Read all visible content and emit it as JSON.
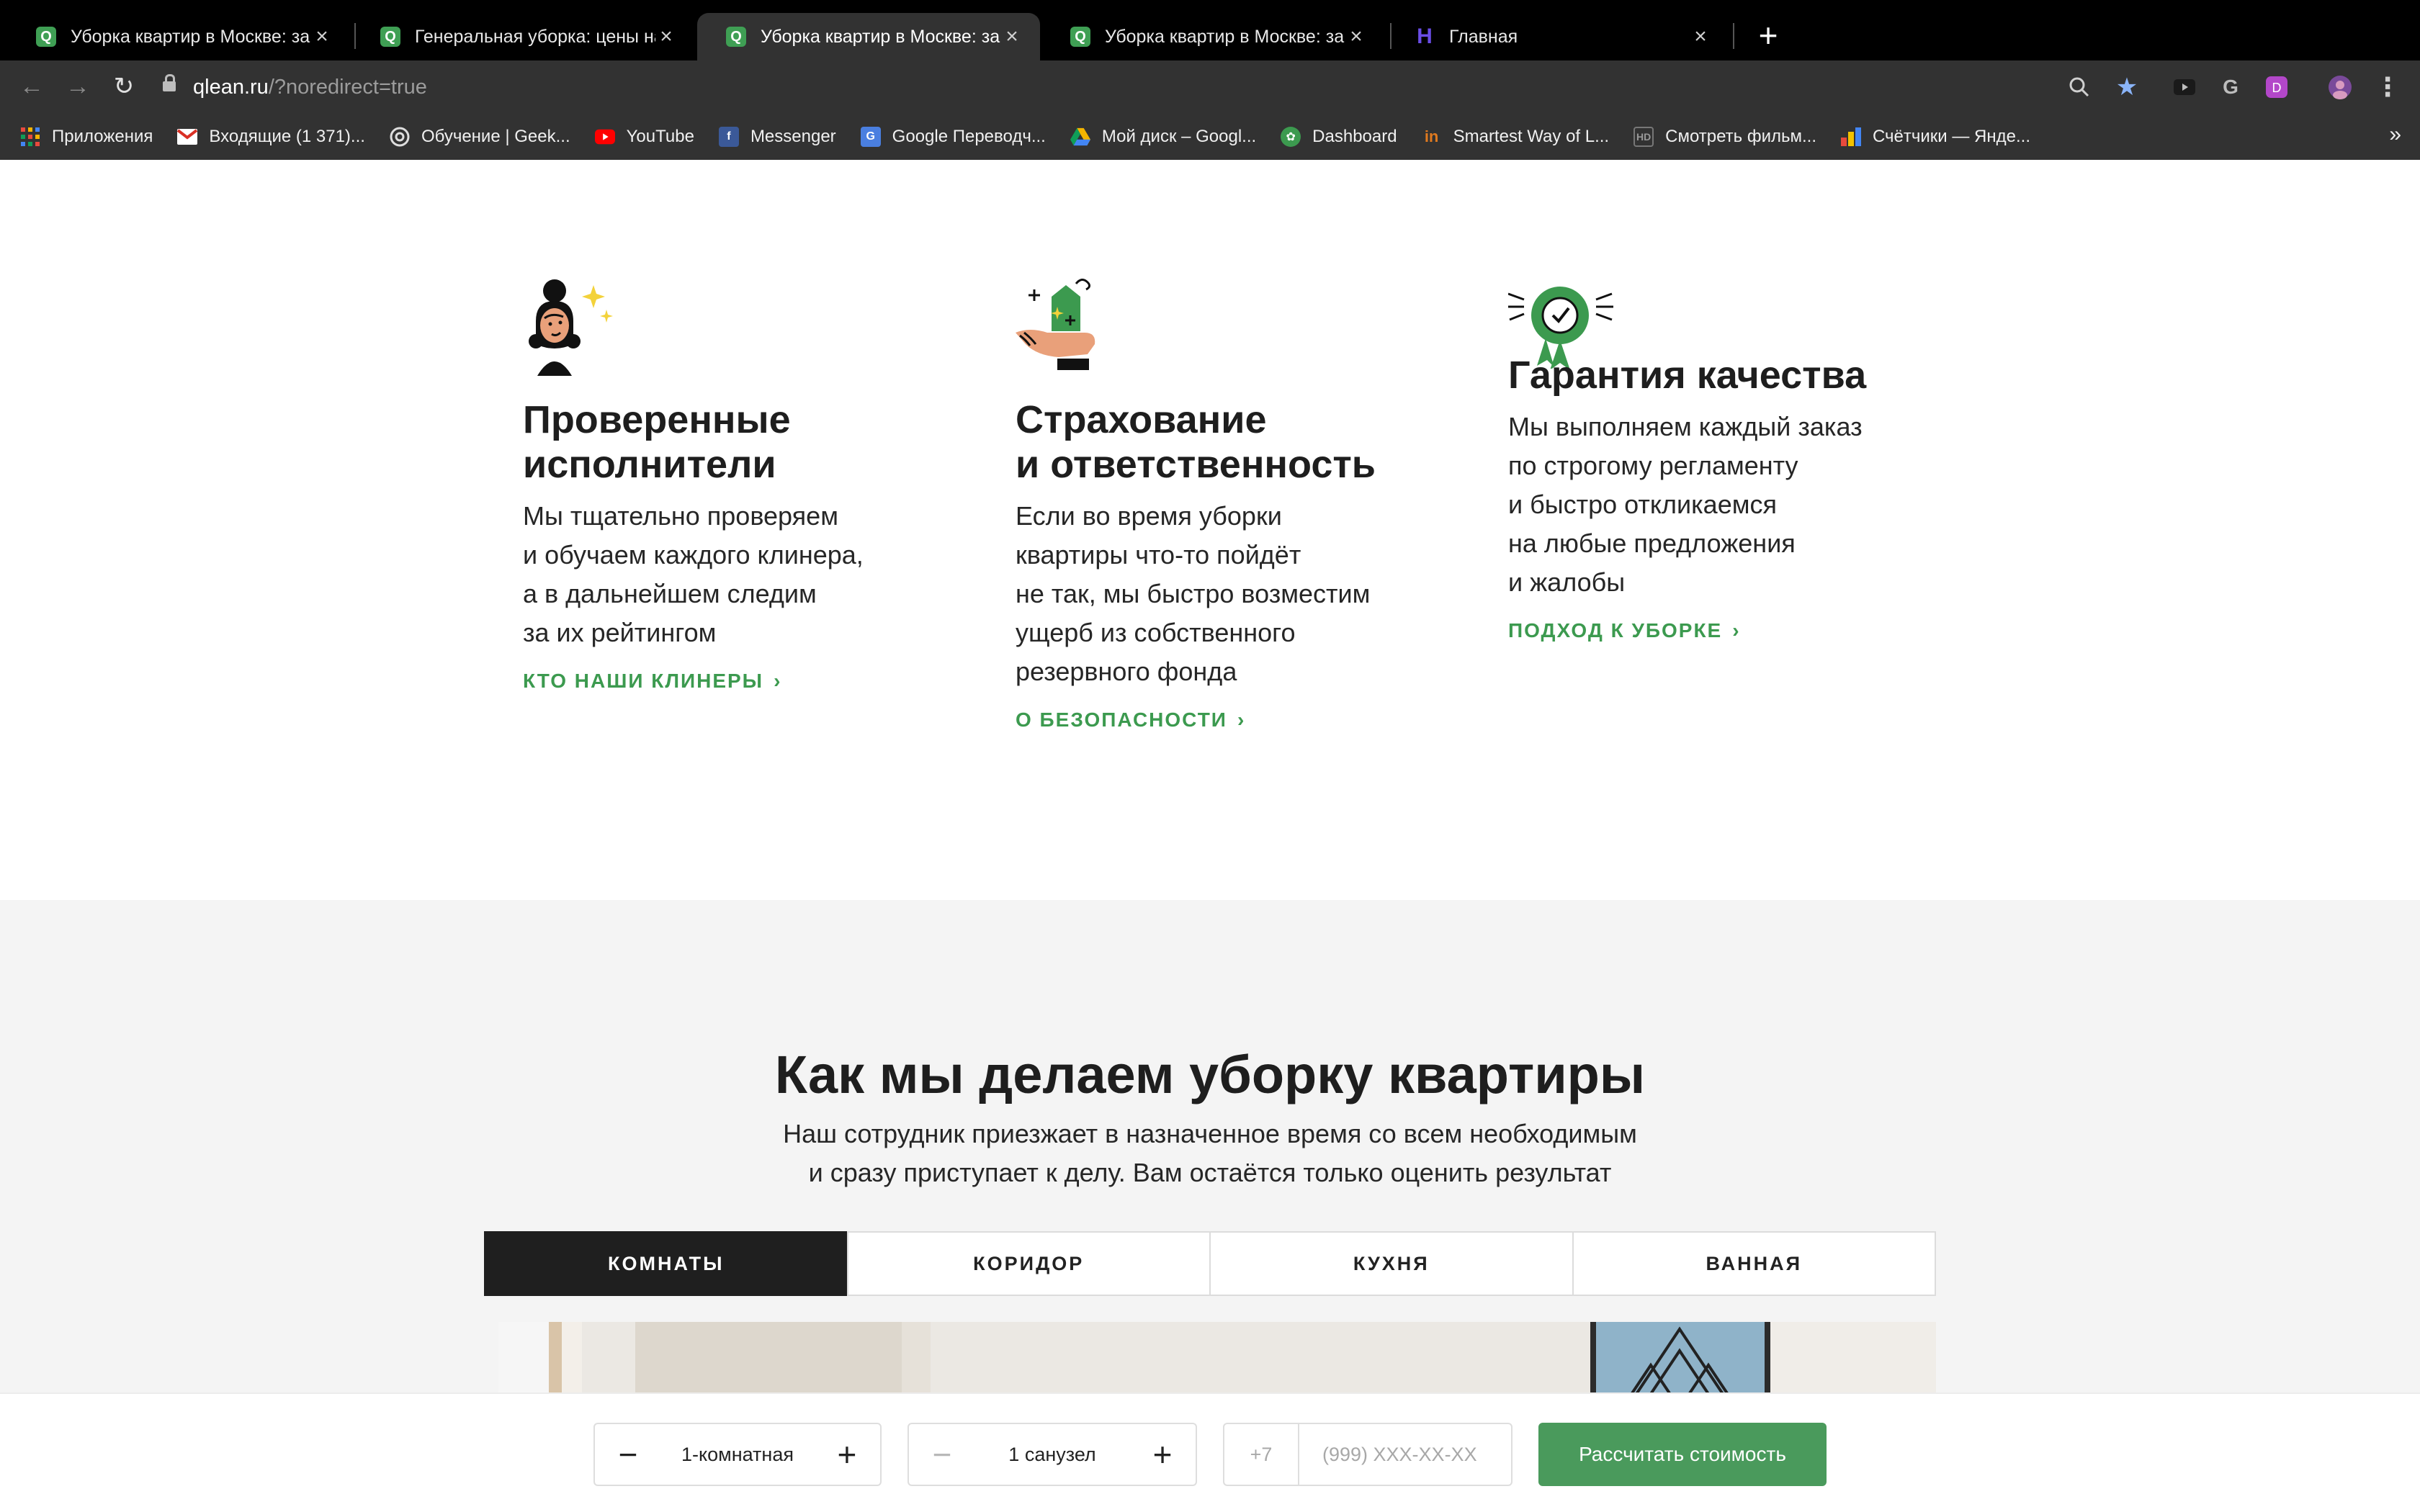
{
  "browser": {
    "tabs": [
      {
        "title": "Уборка квартир в Москве: за",
        "favicon": "Q",
        "active": false
      },
      {
        "title": "Генеральная уборка: цены на",
        "favicon": "Q",
        "active": false
      },
      {
        "title": "Уборка квартир в Москве: за",
        "favicon": "Q",
        "active": true
      },
      {
        "title": "Уборка квартир в Москве: за",
        "favicon": "Q",
        "active": false
      },
      {
        "title": "Главная",
        "favicon": "H",
        "active": false
      }
    ],
    "close_glyph": "×",
    "new_tab_glyph": "+",
    "url_host": "qlean.ru",
    "url_path": "/?noredirect=true",
    "bookmarks": [
      {
        "label": "Приложения",
        "icon": "apps-grid-icon",
        "color": "#e8a33d"
      },
      {
        "label": "Входящие (1 371)...",
        "icon": "gmail-icon",
        "color": "#d93025"
      },
      {
        "label": "Обучение | Geek...",
        "icon": "geekbrains-icon",
        "color": "#888888"
      },
      {
        "label": "YouTube",
        "icon": "youtube-icon",
        "color": "#ff0000"
      },
      {
        "label": "Messenger",
        "icon": "facebook-icon",
        "color": "#3b5998"
      },
      {
        "label": "Google Переводч...",
        "icon": "google-translate-icon",
        "color": "#4a7fe0"
      },
      {
        "label": "Мой диск – Googl...",
        "icon": "google-drive-icon",
        "color": "#2a9d55"
      },
      {
        "label": "Dashboard",
        "icon": "dashboard-icon",
        "color": "#3c9a4f"
      },
      {
        "label": "Smartest Way of L...",
        "icon": "learning-icon",
        "color": "#e07a1f"
      },
      {
        "label": "Смотреть фильм...",
        "icon": "hd-icon",
        "color": "#555555"
      },
      {
        "label": "Счётчики — Янде...",
        "icon": "yandex-metrica-icon",
        "color": "#f2c200"
      }
    ],
    "more_glyph": "»"
  },
  "features": [
    {
      "title_line1": "Проверенные",
      "title_line2": "исполнители",
      "text": [
        "Мы тщательно проверяем",
        "и обучаем каждого клинера,",
        "а в дальнейшем следим",
        "за их рейтингом"
      ],
      "link": "КТО НАШИ КЛИНЕРЫ",
      "icon": "cleaner-woman-icon"
    },
    {
      "title_line1": "Страхование",
      "title_line2": "и ответственность",
      "text": [
        "Если во время уборки",
        "квартиры что-то пойдёт",
        "не так, мы быстро возместим",
        "ущерб из собственного",
        "резервного фонда"
      ],
      "link": "О БЕЗОПАСНОСТИ",
      "icon": "insurance-hand-icon"
    },
    {
      "title_line1": "Гарантия качества",
      "title_line2": "",
      "text": [
        "Мы выполняем каждый заказ",
        "по строгому регламенту",
        "и быстро откликаемся",
        "на любые предложения",
        "и жалобы"
      ],
      "link": "ПОДХОД К УБОРКЕ",
      "icon": "quality-badge-icon"
    }
  ],
  "link_chevron": "›",
  "how": {
    "title": "Как мы делаем уборку квартиры",
    "subtitle_line1": "Наш сотрудник приезжает в назначенное время со всем необходимым",
    "subtitle_line2": "и сразу приступает к делу. Вам остаётся только оценить результат",
    "tabs": [
      "КОМНАТЫ",
      "КОРИДОР",
      "КУХНЯ",
      "ВАННАЯ"
    ],
    "active_tab": 0
  },
  "calculator": {
    "rooms_value": "1-комнатная",
    "bathrooms_value": "1 санузел",
    "minus": "−",
    "plus": "+",
    "phone_code": "+7",
    "phone_placeholder": "(999) XXX-XX-XX",
    "submit_label": "Рассчитать стоимость"
  },
  "colors": {
    "accent_green": "#3c9a4f",
    "button_green": "#4a9a5c",
    "tab_active_dark": "#1f1f1f"
  }
}
